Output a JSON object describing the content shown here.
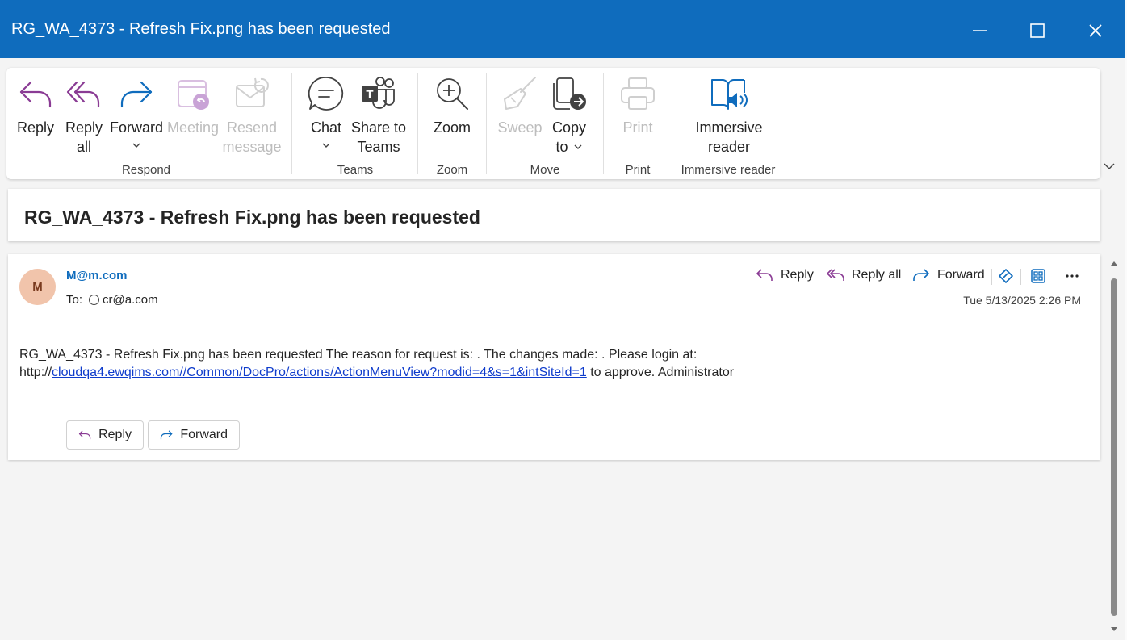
{
  "window": {
    "title": "RG_WA_4373 - Refresh Fix.png has been requested"
  },
  "ribbon": {
    "respond": {
      "label": "Respond",
      "reply": "Reply",
      "reply_all_1": "Reply",
      "reply_all_2": "all",
      "forward": "Forward",
      "meeting": "Meeting",
      "resend_1": "Resend",
      "resend_2": "message"
    },
    "teams": {
      "label": "Teams",
      "chat": "Chat",
      "share_1": "Share to",
      "share_2": "Teams"
    },
    "zoom": {
      "label": "Zoom",
      "zoom": "Zoom"
    },
    "move": {
      "label": "Move",
      "sweep": "Sweep",
      "copy_1": "Copy",
      "copy_2": "to"
    },
    "print": {
      "label": "Print",
      "print": "Print"
    },
    "immersive": {
      "label": "Immersive reader",
      "btn_1": "Immersive",
      "btn_2": "reader"
    }
  },
  "subject": "RG_WA_4373 - Refresh Fix.png has been requested",
  "message": {
    "avatar_initial": "M",
    "sender": "M@m.com",
    "to_label": "To:",
    "to_address": "cr@a.com",
    "date": "Tue 5/13/2025 2:26 PM",
    "actions": {
      "reply": "Reply",
      "reply_all": "Reply all",
      "forward": "Forward"
    },
    "body_part1": "RG_WA_4373 - Refresh Fix.png has been requested The reason for request is: . The changes made: . Please login at:",
    "body_http": "http://",
    "body_link": "cloudqa4.ewqims.com//Common/DocPro/actions/ActionMenuView?modid=4&s=1&intSiteId=1",
    "body_part2": " to approve. Administrator",
    "bottom_reply": "Reply",
    "bottom_forward": "Forward"
  },
  "colors": {
    "titlebar": "#0f6cbd",
    "reply_icon": "#8a3b94",
    "forward_icon": "#0f6cbd",
    "link": "#0f3ccc"
  }
}
